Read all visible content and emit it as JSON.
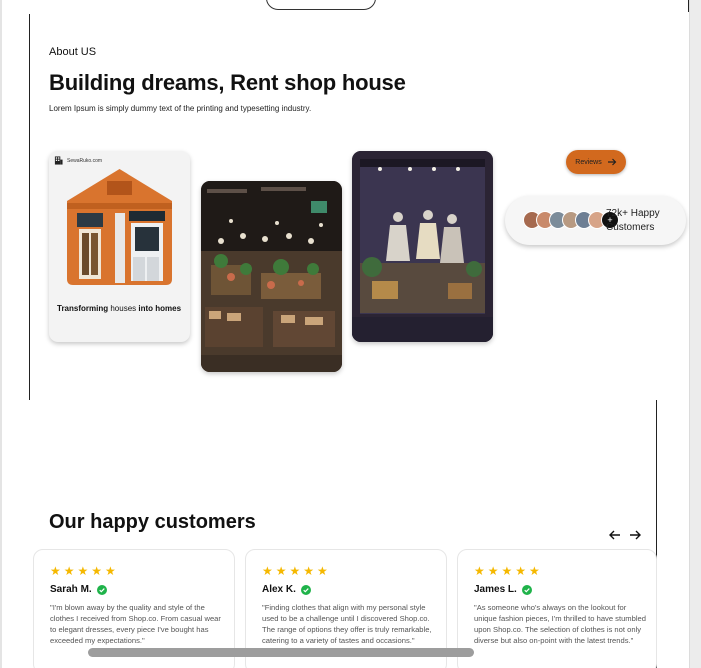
{
  "about": {
    "label": "About US",
    "headline": "Building dreams, Rent shop house",
    "subtitle": "Lorem Ipsum is simply dummy text of the printing and typesetting industry."
  },
  "brand_card": {
    "brand_name": "SewaRuko.com",
    "tagline_bold_1": "Transforming",
    "tagline_plain": " houses ",
    "tagline_bold_2": "into homes"
  },
  "reviews_button": {
    "label": "Reviews"
  },
  "happy_customers": {
    "line1": "72k+ Happy",
    "line2": "Customers",
    "more_symbol": "+"
  },
  "customers_section": {
    "title": "Our happy customers",
    "reviews": [
      {
        "stars": "★★★★★",
        "name": "Sarah M.",
        "text": "\"I'm blown away by the quality and style of the clothes I received from Shop.co. From casual wear to elegant dresses, every piece I've bought has exceeded my expectations.\""
      },
      {
        "stars": "★★★★★",
        "name": "Alex K.",
        "text": "\"Finding clothes that align with my personal style used to be a challenge until I discovered Shop.co. The range of options they offer is truly remarkable, catering to a variety of tastes and occasions.\""
      },
      {
        "stars": "★★★★★",
        "name": "James L.",
        "text": "\"As someone who's always on the lookout for unique fashion pieces, I'm thrilled to have stumbled upon Shop.co. The selection of clothes is not only diverse but also on-point with the latest trends.\""
      }
    ]
  },
  "colors": {
    "accent": "#d2691e",
    "star": "#f5b800",
    "verified": "#1fb34a"
  },
  "icons": [
    "building-icon",
    "arrow-right-icon",
    "arrow-left-icon",
    "verified-check-icon"
  ]
}
